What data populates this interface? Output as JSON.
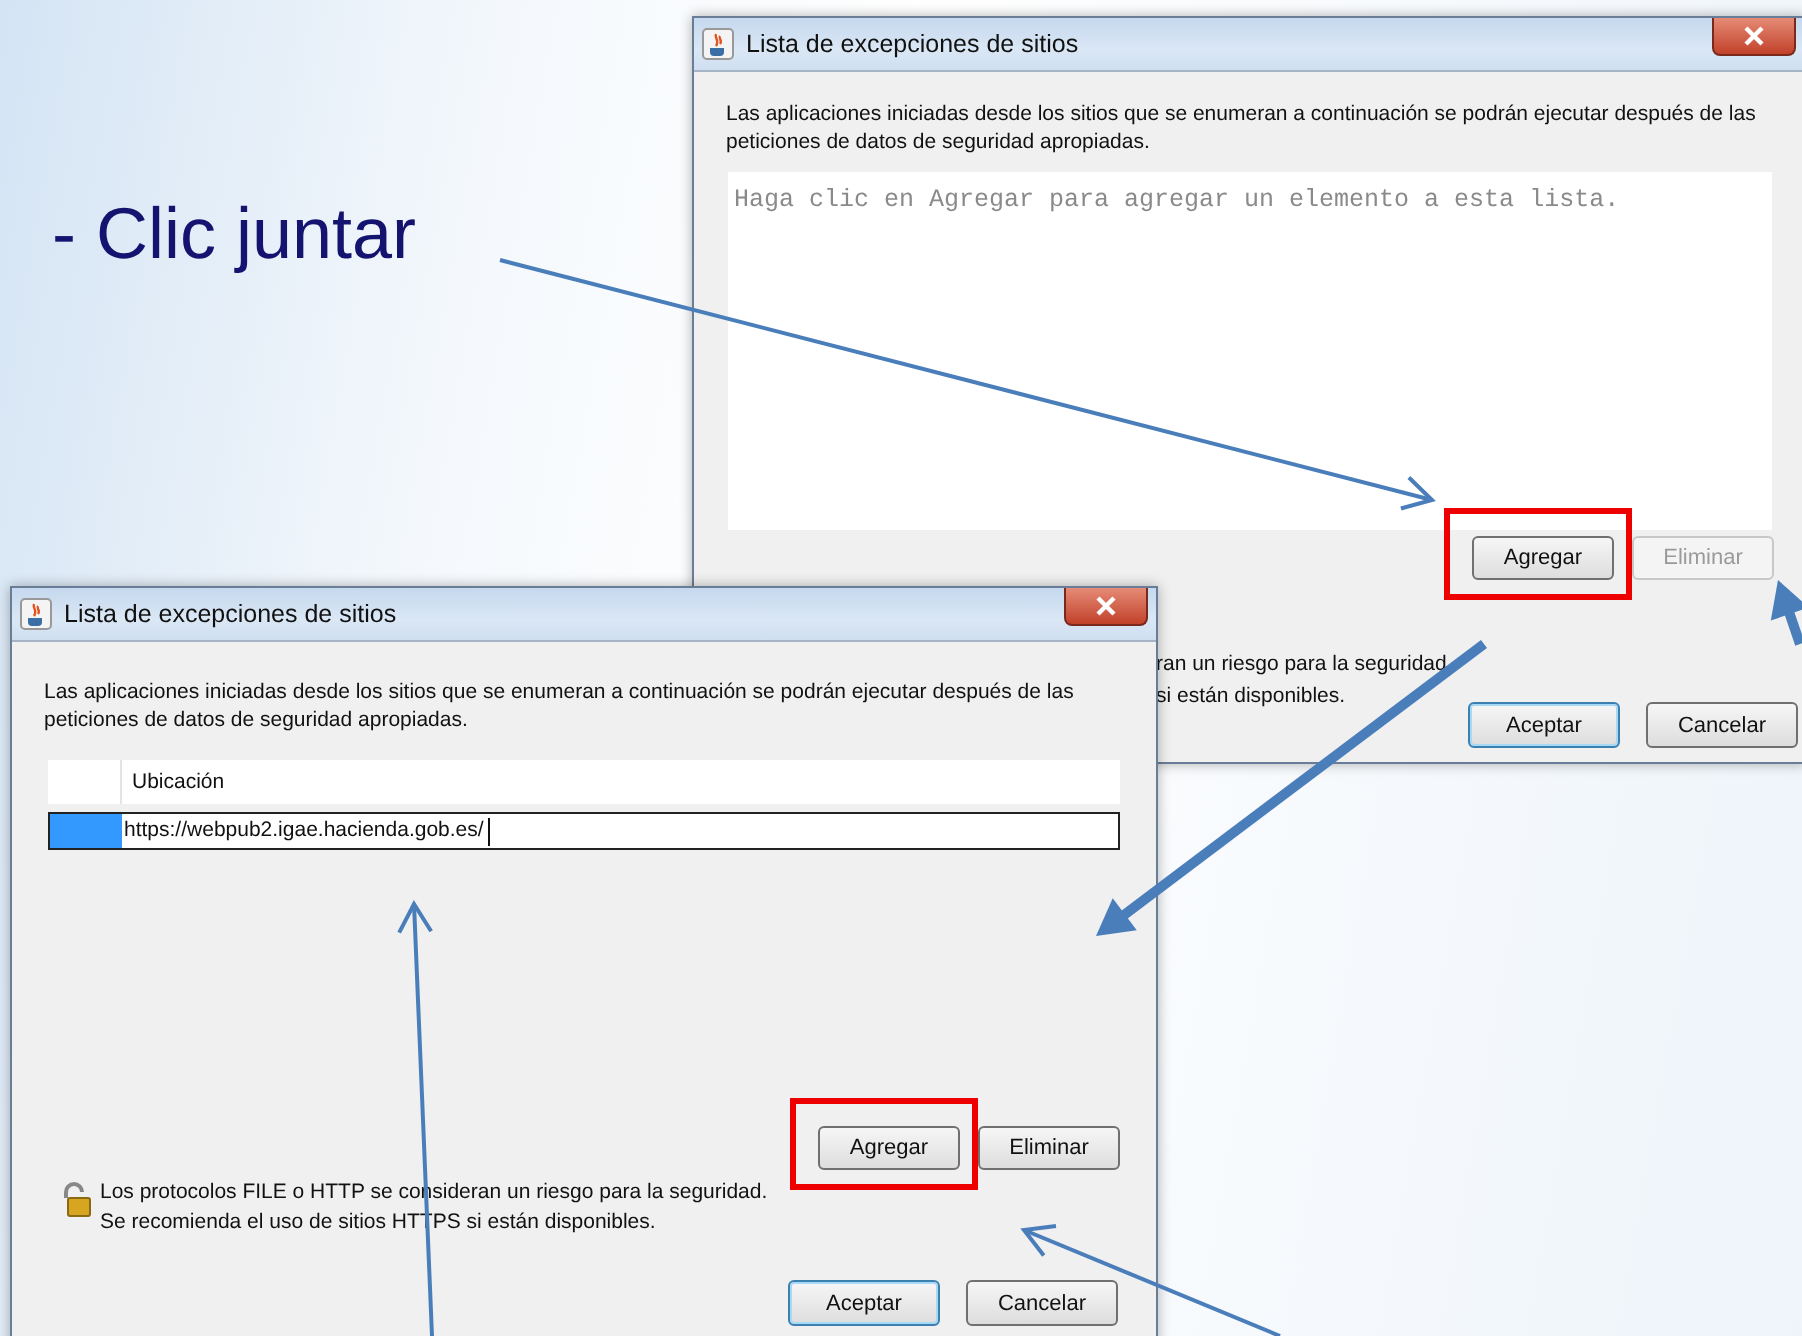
{
  "slide_text": "- Clic juntar",
  "back_dialog": {
    "title": "Lista de excepciones de sitios",
    "description": "Las aplicaciones iniciadas desde los sitios que se enumeran a continuación se podrán ejecutar después de las peticiones de datos de seguridad apropiadas.",
    "list_placeholder": "Haga clic en Agregar para agregar un elemento a esta lista.",
    "list_buttons": [
      {
        "label": "Agregar",
        "disabled": false,
        "highlighted": true
      },
      {
        "label": "Eliminar",
        "disabled": true,
        "highlighted": false
      }
    ],
    "security_note_lines": [
      "ran un riesgo para la seguridad",
      "si están disponibles."
    ],
    "buttons": [
      {
        "label": "Aceptar",
        "default": true
      },
      {
        "label": "Cancelar",
        "default": false
      }
    ]
  },
  "front_dialog": {
    "title": "Lista de excepciones de sitios",
    "description": "Las aplicaciones iniciadas desde los sitios que se enumeran a continuación se podrán ejecutar después de las peticiones de datos de seguridad apropiadas.",
    "table": {
      "columns": [
        "Ubicación"
      ],
      "rows": [
        {
          "value": "https://webpub2.igae.hacienda.gob.es/",
          "selected": true
        }
      ]
    },
    "list_buttons": [
      {
        "label": "Agregar",
        "disabled": false,
        "highlighted": true
      },
      {
        "label": "Eliminar",
        "disabled": false,
        "highlighted": false
      }
    ],
    "security_note_lines": [
      "Los protocolos FILE o HTTP se consideran un riesgo para la seguridad.",
      "Se recomienda el uso de sitios HTTPS si están disponibles."
    ],
    "buttons": [
      {
        "label": "Aceptar",
        "default": true
      },
      {
        "label": "Cancelar",
        "default": false
      }
    ]
  }
}
